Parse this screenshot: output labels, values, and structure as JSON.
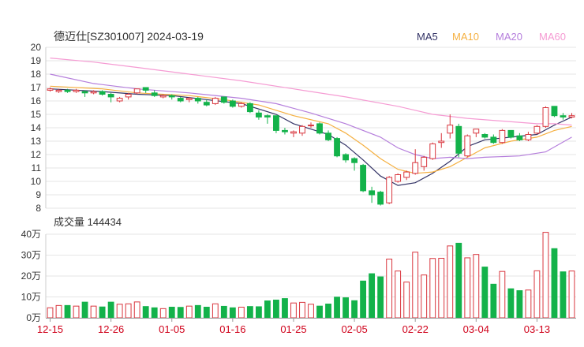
{
  "chart_data": [
    {
      "type": "candlestick",
      "title": "德迈仕[SZ301007] 2024-03-19",
      "ylim": [
        8,
        20
      ],
      "yticks": [
        "20",
        "19",
        "18",
        "17",
        "16",
        "15",
        "14",
        "13",
        "12",
        "11",
        "10",
        "9",
        "8"
      ],
      "legend": [
        {
          "name": "MA5",
          "color": "#333366"
        },
        {
          "name": "MA10",
          "color": "#f5b041"
        },
        {
          "name": "MA20",
          "color": "#b57edc"
        },
        {
          "name": "MA60",
          "color": "#f59bd3"
        }
      ],
      "colors": {
        "up": "#d9363e",
        "down": "#13b24a"
      },
      "candles": [
        [
          16.8,
          16.9,
          16.7,
          17.0
        ],
        [
          16.7,
          16.8,
          16.6,
          16.9
        ],
        [
          16.8,
          16.7,
          16.6,
          16.9
        ],
        [
          16.7,
          16.8,
          16.6,
          16.9
        ],
        [
          16.7,
          16.6,
          16.3,
          16.8
        ],
        [
          16.6,
          16.7,
          16.5,
          16.8
        ],
        [
          16.7,
          16.5,
          16.4,
          16.8
        ],
        [
          16.5,
          16.3,
          15.9,
          16.6
        ],
        [
          16.0,
          16.2,
          15.9,
          16.3
        ],
        [
          16.3,
          16.5,
          16.1,
          16.6
        ],
        [
          16.6,
          16.9,
          16.5,
          16.9
        ],
        [
          17.0,
          16.8,
          16.6,
          17.0
        ],
        [
          16.6,
          16.4,
          16.3,
          16.8
        ],
        [
          16.3,
          16.4,
          16.2,
          16.5
        ],
        [
          16.4,
          16.3,
          16.1,
          16.5
        ],
        [
          16.2,
          16.0,
          15.9,
          16.3
        ],
        [
          16.1,
          16.2,
          15.9,
          16.3
        ],
        [
          16.2,
          16.0,
          15.8,
          16.3
        ],
        [
          15.9,
          15.7,
          15.6,
          16.1
        ],
        [
          15.8,
          16.2,
          15.7,
          16.3
        ],
        [
          16.3,
          15.9,
          15.8,
          16.3
        ],
        [
          16.0,
          15.6,
          15.5,
          16.1
        ],
        [
          15.6,
          15.8,
          15.5,
          15.9
        ],
        [
          15.8,
          15.2,
          15.1,
          15.9
        ],
        [
          15.1,
          14.8,
          14.6,
          15.3
        ],
        [
          14.9,
          14.8,
          14.3,
          15.0
        ],
        [
          14.9,
          13.8,
          13.6,
          14.9
        ],
        [
          13.8,
          13.7,
          13.5,
          14.0
        ],
        [
          13.6,
          13.7,
          13.3,
          13.8
        ],
        [
          13.6,
          14.1,
          13.4,
          14.2
        ],
        [
          14.2,
          14.2,
          14.0,
          14.4
        ],
        [
          14.3,
          13.6,
          13.5,
          14.4
        ],
        [
          13.6,
          13.1,
          13.0,
          13.8
        ],
        [
          13.2,
          11.9,
          11.8,
          13.3
        ],
        [
          12.0,
          11.6,
          11.4,
          12.1
        ],
        [
          11.7,
          11.4,
          10.8,
          11.8
        ],
        [
          11.2,
          9.3,
          9.2,
          11.3
        ],
        [
          9.3,
          9.0,
          8.4,
          9.6
        ],
        [
          9.2,
          8.3,
          8.2,
          9.3
        ],
        [
          8.4,
          10.3,
          8.3,
          10.4
        ],
        [
          10.0,
          10.5,
          9.9,
          10.6
        ],
        [
          10.3,
          10.7,
          10.1,
          10.8
        ],
        [
          10.6,
          11.4,
          10.5,
          12.4
        ],
        [
          11.1,
          11.8,
          10.8,
          11.9
        ],
        [
          11.7,
          12.8,
          11.6,
          12.9
        ],
        [
          12.9,
          13.0,
          12.5,
          13.6
        ],
        [
          13.6,
          14.2,
          13.2,
          15.0
        ],
        [
          14.1,
          12.1,
          11.8,
          14.3
        ],
        [
          11.9,
          13.4,
          11.8,
          13.5
        ],
        [
          13.6,
          13.9,
          13.3,
          13.9
        ],
        [
          13.5,
          13.3,
          13.2,
          13.6
        ],
        [
          13.3,
          12.9,
          12.8,
          13.5
        ],
        [
          12.9,
          13.8,
          12.8,
          13.9
        ],
        [
          13.8,
          13.3,
          13.2,
          13.8
        ],
        [
          13.4,
          13.1,
          13.0,
          13.6
        ],
        [
          13.1,
          13.5,
          13.0,
          13.7
        ],
        [
          13.6,
          14.1,
          13.5,
          14.2
        ],
        [
          14.1,
          15.5,
          14.0,
          15.6
        ],
        [
          15.6,
          14.9,
          14.8,
          15.6
        ],
        [
          14.9,
          14.8,
          14.6,
          15.1
        ],
        [
          14.8,
          14.9,
          14.7,
          15.1
        ]
      ],
      "ma": {
        "MA5": [
          [
            0,
            16.9
          ],
          [
            6,
            16.7
          ],
          [
            10,
            16.5
          ],
          [
            14,
            16.4
          ],
          [
            18,
            16.1
          ],
          [
            22,
            15.8
          ],
          [
            26,
            15.0
          ],
          [
            28,
            14.3
          ],
          [
            32,
            13.5
          ],
          [
            34,
            12.7
          ],
          [
            36,
            11.6
          ],
          [
            38,
            10.4
          ],
          [
            40,
            9.7
          ],
          [
            42,
            9.9
          ],
          [
            44,
            10.6
          ],
          [
            46,
            11.5
          ],
          [
            48,
            12.6
          ],
          [
            50,
            13.1
          ],
          [
            53,
            13.3
          ],
          [
            56,
            13.5
          ],
          [
            58,
            14.2
          ],
          [
            60,
            14.8
          ]
        ],
        "MA10": [
          [
            0,
            17.1
          ],
          [
            6,
            16.9
          ],
          [
            10,
            16.6
          ],
          [
            16,
            16.4
          ],
          [
            20,
            16.1
          ],
          [
            24,
            15.7
          ],
          [
            28,
            14.9
          ],
          [
            32,
            14.3
          ],
          [
            34,
            13.6
          ],
          [
            36,
            12.7
          ],
          [
            38,
            11.7
          ],
          [
            40,
            10.9
          ],
          [
            42,
            10.6
          ],
          [
            44,
            10.7
          ],
          [
            46,
            11.1
          ],
          [
            48,
            11.8
          ],
          [
            50,
            12.5
          ],
          [
            53,
            13.0
          ],
          [
            56,
            13.3
          ],
          [
            58,
            13.8
          ],
          [
            60,
            14.1
          ]
        ],
        "MA20": [
          [
            0,
            18.0
          ],
          [
            5,
            17.3
          ],
          [
            10,
            16.9
          ],
          [
            16,
            16.6
          ],
          [
            22,
            16.2
          ],
          [
            26,
            15.8
          ],
          [
            30,
            15.1
          ],
          [
            34,
            14.3
          ],
          [
            38,
            13.3
          ],
          [
            40,
            12.5
          ],
          [
            42,
            12.0
          ],
          [
            44,
            11.7
          ],
          [
            46,
            11.8
          ],
          [
            48,
            11.7
          ],
          [
            50,
            11.8
          ],
          [
            54,
            11.9
          ],
          [
            57,
            12.2
          ],
          [
            60,
            13.3
          ]
        ],
        "MA60": [
          [
            0,
            19.2
          ],
          [
            5,
            18.9
          ],
          [
            10,
            18.5
          ],
          [
            16,
            18.0
          ],
          [
            22,
            17.5
          ],
          [
            28,
            16.9
          ],
          [
            34,
            16.3
          ],
          [
            40,
            15.6
          ],
          [
            44,
            15.0
          ],
          [
            48,
            14.7
          ],
          [
            52,
            14.5
          ],
          [
            56,
            14.3
          ],
          [
            58,
            14.3
          ],
          [
            60,
            14.2
          ]
        ]
      },
      "xticks": [
        {
          "i": 0,
          "label": "12-15"
        },
        {
          "i": 7,
          "label": "12-26"
        },
        {
          "i": 14,
          "label": "01-05"
        },
        {
          "i": 21,
          "label": "01-16"
        },
        {
          "i": 28,
          "label": "01-25"
        },
        {
          "i": 35,
          "label": "02-05"
        },
        {
          "i": 42,
          "label": "02-22"
        },
        {
          "i": 49,
          "label": "03-04"
        },
        {
          "i": 56,
          "label": "03-13"
        }
      ]
    },
    {
      "type": "bar",
      "title": "成交量 144434",
      "ylim": [
        0,
        40
      ],
      "yticks": [
        "40万",
        "30万",
        "20万",
        "10万",
        "0万"
      ],
      "volumes": [
        4.8,
        5.9,
        5.9,
        5.6,
        7.5,
        5.6,
        5.2,
        7.5,
        6.5,
        6.7,
        7.6,
        5.4,
        4.8,
        4.4,
        5.1,
        5.0,
        5.6,
        5.9,
        5.1,
        6.7,
        5.5,
        4.8,
        5.1,
        5.4,
        5.3,
        8.1,
        8.5,
        9.2,
        7.1,
        7.4,
        6.5,
        5.6,
        6.6,
        9.9,
        9.6,
        8.2,
        17.6,
        21.1,
        19.6,
        28.1,
        22.4,
        17.1,
        31.4,
        20.5,
        28.4,
        28.5,
        34.4,
        35.7,
        28.7,
        30.3,
        24.3,
        16.1,
        22.2,
        13.9,
        13.0,
        13.3,
        22.5,
        40.9,
        33.1,
        22.0,
        22.4
      ]
    }
  ]
}
